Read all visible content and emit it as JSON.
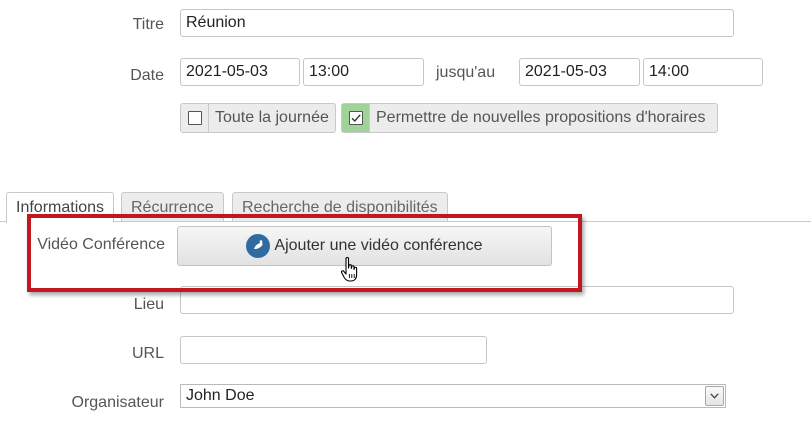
{
  "form": {
    "title_label": "Titre",
    "title_value": "Réunion",
    "date_label": "Date",
    "start_date": "2021-05-03",
    "start_time": "13:00",
    "until_label": "jusqu'au",
    "end_date": "2021-05-03",
    "end_time": "14:00",
    "all_day_label": "Toute la journée",
    "all_day_checked": false,
    "allow_proposals_label": "Permettre de nouvelles propositions d'horaires",
    "allow_proposals_checked": true
  },
  "tabs": [
    {
      "label": "Informations",
      "active": true
    },
    {
      "label": "Récurrence",
      "active": false
    },
    {
      "label": "Recherche de disponibilités",
      "active": false
    }
  ],
  "info": {
    "video_label": "Vidéo Conférence",
    "video_button_label": "Ajouter une vidéo conférence",
    "location_label": "Lieu",
    "location_value": "",
    "url_label": "URL",
    "url_value": "",
    "organizer_label": "Organisateur",
    "organizer_value": "John Doe"
  },
  "colors": {
    "highlight": "#c0181e",
    "checkbox_checked_bg": "#9fd39a",
    "video_icon_bg": "#2f6aa0"
  }
}
